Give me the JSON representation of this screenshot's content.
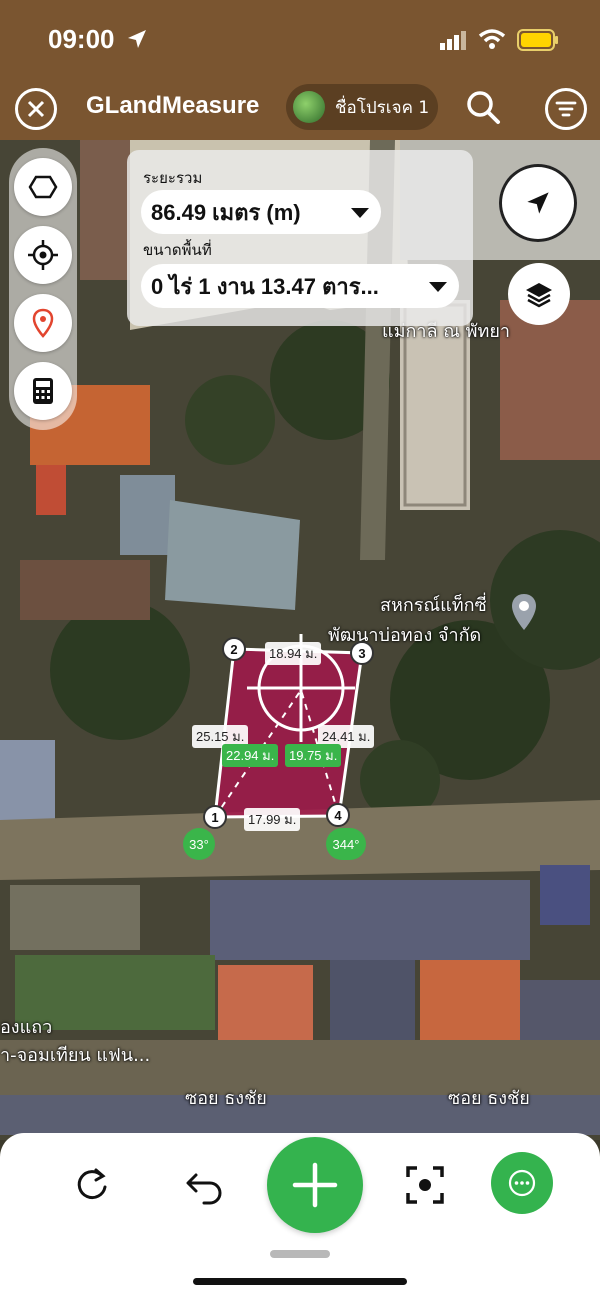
{
  "status_bar": {
    "time": "09:00"
  },
  "header": {
    "title": "GLandMeasure",
    "project_name": "ชื่อโปรเจค 1",
    "icons": [
      "close-icon",
      "search-icon",
      "menu-icon"
    ]
  },
  "info_panel": {
    "total_distance_label": "ระยะรวม",
    "total_distance_value": "86.49 เมตร (m)",
    "area_label": "ขนาดพื้นที่",
    "area_value": "0 ไร่ 1 งาน 13.47 ตาร..."
  },
  "left_toolbar": {
    "tools": [
      "polygon-icon",
      "crosshair-icon",
      "pin-icon",
      "calculator-icon"
    ]
  },
  "map": {
    "places": [
      {
        "name": "แม่กาลี ณ พัทยา"
      },
      {
        "name": "สหกรณ์แท็กซี่"
      },
      {
        "name": "พัฒนาบ่อทอง จำกัด"
      },
      {
        "name": "องแถว"
      },
      {
        "name": "า-จอมเทียน แฟน..."
      },
      {
        "name": "ซอย ธงชัย"
      },
      {
        "name": "ซอย ธงชัย"
      }
    ],
    "measurements": {
      "top": "18.94 ม.",
      "left": "25.15 ม.",
      "right": "24.41 ม.",
      "bottom": "17.99 ม.",
      "diag_left": "22.94 ม.",
      "diag_right": "19.75 ม."
    },
    "vertices": [
      "1",
      "2",
      "3",
      "4"
    ],
    "angles": [
      "33°",
      "344°"
    ],
    "polygon_color": "#a3184b"
  },
  "bottom_bar": {
    "icons": [
      "refresh-icon",
      "undo-icon",
      "add-icon",
      "focus-icon",
      "more-icon"
    ],
    "accent_color": "#34b34e"
  }
}
